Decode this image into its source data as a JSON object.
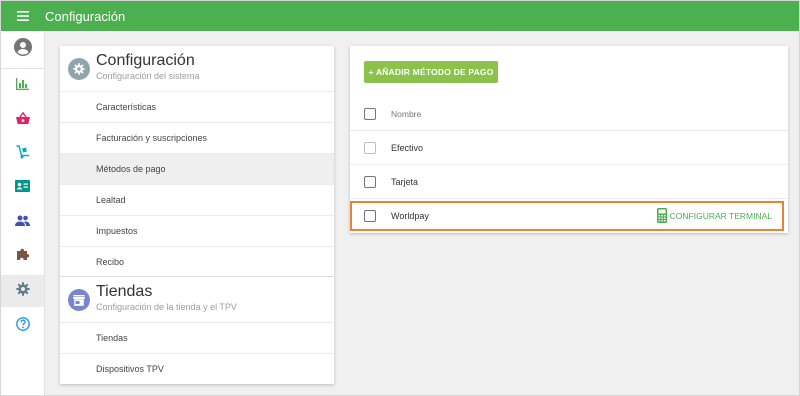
{
  "app": {
    "title": "Configuración"
  },
  "icons": {
    "menu": "hamburger-menu-icon",
    "rail": [
      "account-circle-icon",
      "bar-chart-icon",
      "basket-icon",
      "hand-truck-icon",
      "id-card-icon",
      "people-icon",
      "puzzle-icon",
      "gear-icon",
      "help-circle-icon"
    ]
  },
  "colors": {
    "primary": "#4caf50",
    "button": "#8bc34a",
    "highlight": "#e8843a",
    "basket": "#e91e63",
    "truck": "#00acc1",
    "idcard": "#009688",
    "people": "#3f51b5",
    "puzzle": "#795548",
    "gear": "#607d8b",
    "help": "#2196f3",
    "tiendas_icon": "#7986cb"
  },
  "settings": {
    "config_section": {
      "title": "Configuración",
      "subtitle": "Configuración del sistema",
      "items": [
        "Características",
        "Facturación y suscripciones",
        "Métodos de pago",
        "Lealtad",
        "Impuestos",
        "Recibo"
      ],
      "active_item": "Métodos de pago"
    },
    "stores_section": {
      "title": "Tiendas",
      "subtitle": "Configuración de la tienda y el TPV",
      "items": [
        "Tiendas",
        "Dispositivos TPV"
      ]
    }
  },
  "payment_methods": {
    "add_button": "+ AÑADIR MÉTODO DE PAGO",
    "column_header": "Nombre",
    "rows": [
      {
        "name": "Efectivo",
        "action": ""
      },
      {
        "name": "Tarjeta",
        "action": ""
      },
      {
        "name": "Worldpay",
        "action": "CONFIGURAR TERMINAL"
      }
    ]
  }
}
